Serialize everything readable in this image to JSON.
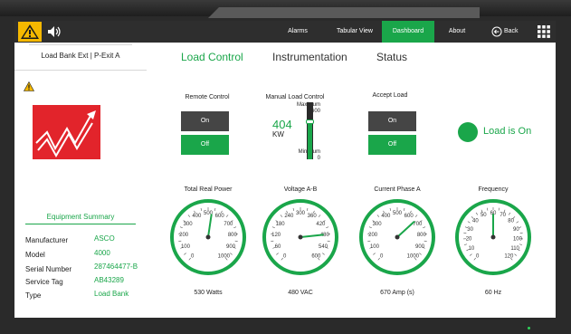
{
  "nav": {
    "items": [
      {
        "label": "Alarms"
      },
      {
        "label": "Tabular View"
      },
      {
        "label": "Dashboard",
        "active": true
      },
      {
        "label": "About"
      }
    ],
    "back_label": "Back"
  },
  "device": {
    "title": "Load Bank Ext | P-Exit A"
  },
  "summary": {
    "title": "Equipment Summary",
    "rows": [
      {
        "label": "Manufacturer",
        "value": "ASCO"
      },
      {
        "label": "Model",
        "value": "4000"
      },
      {
        "label": "Serial Number",
        "value": "287464477-B"
      },
      {
        "label": "Service Tag",
        "value": "AB43289"
      },
      {
        "label": "Type",
        "value": "Load Bank"
      }
    ]
  },
  "tabs": [
    {
      "label": "Load Control",
      "active": true
    },
    {
      "label": "Instrumentation"
    },
    {
      "label": "Status"
    }
  ],
  "remote_control": {
    "label": "Remote Control",
    "on_label": "On",
    "off_label": "Off",
    "selected": "Off"
  },
  "manual_load": {
    "label": "Manual Load Control",
    "max_label": "Maximum",
    "max_value": "600",
    "min_label": "Minimum",
    "min_value": "0",
    "value": "404",
    "unit": "KW",
    "level": 0.67
  },
  "accept_load": {
    "label": "Accept Load",
    "on_label": "On",
    "off_label": "Off",
    "selected": "Off"
  },
  "status": {
    "text": "Load is On",
    "color": "#1aa64a"
  },
  "gauges": [
    {
      "title": "Total Real Power",
      "ticks": [
        "0",
        "100",
        "200",
        "300",
        "400",
        "500",
        "600",
        "700",
        "800",
        "900",
        "1000"
      ],
      "min": 0,
      "max": 1000,
      "value": 530,
      "reading": "530 Watts"
    },
    {
      "title": "Voltage A-B",
      "ticks": [
        "0",
        "60",
        "120",
        "180",
        "240",
        "300",
        "360",
        "420",
        "480",
        "540",
        "600"
      ],
      "min": 0,
      "max": 600,
      "value": 480,
      "reading": "480 VAC"
    },
    {
      "title": "Current Phase A",
      "ticks": [
        "0",
        "100",
        "200",
        "300",
        "400",
        "500",
        "600",
        "700",
        "800",
        "900",
        "1000"
      ],
      "min": 0,
      "max": 1000,
      "value": 670,
      "reading": "670 Amp (s)"
    },
    {
      "title": "Frequency",
      "ticks": [
        "0",
        "10",
        "20",
        "30",
        "40",
        "50",
        "60",
        "70",
        "80",
        "90",
        "100",
        "110",
        "120"
      ],
      "min": 0,
      "max": 120,
      "value": 60,
      "reading": "60 Hz"
    }
  ],
  "colors": {
    "accent": "#1aa64a",
    "warning": "#f5b800",
    "logo": "#e2242b",
    "navbar": "#2e2e2e"
  },
  "icons": {
    "warning": "warning-icon",
    "sound": "speaker-icon",
    "back": "back-arrow-icon",
    "grid": "grid-menu-icon",
    "logo": "trend-chart-logo"
  }
}
